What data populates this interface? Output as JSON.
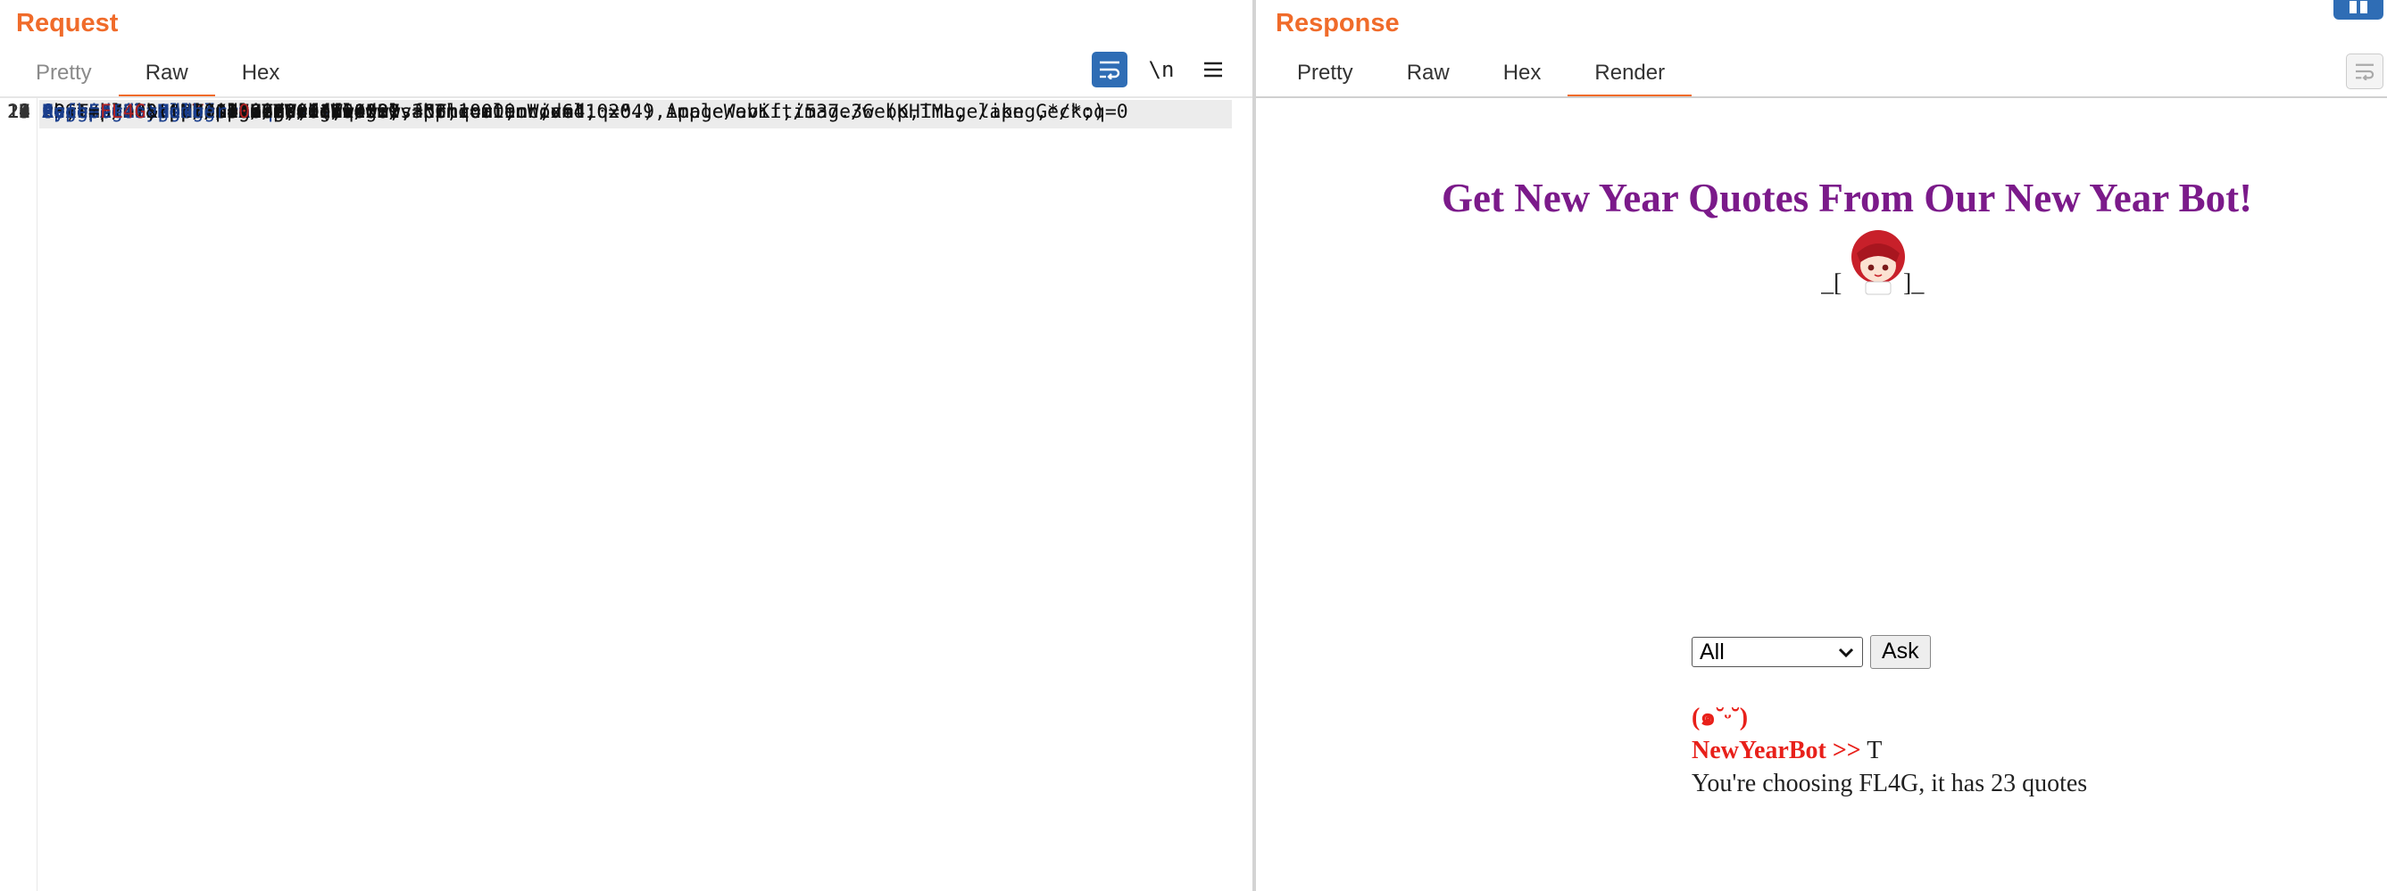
{
  "request": {
    "title": "Request",
    "tabs": [
      "Pretty",
      "Raw",
      "Hex"
    ],
    "active_tab": "Raw",
    "toolbar": {
      "wrap_icon": "wrap-lines-icon",
      "newline_label": "\\n",
      "menu_icon": "hamburger-menu-icon"
    },
    "lines": [
      {
        "n": "1",
        "key": "POST /?",
        "param": "debug",
        "eq": "=",
        "val": "True",
        "rest": " HTTP/1.1"
      },
      {
        "n": "2",
        "key": "Host",
        "rest": ": 127.0.0.1:5000"
      },
      {
        "n": "3",
        "key": "Content-Length",
        "rest": ": 18"
      },
      {
        "n": "4",
        "key": "Cache-Control",
        "rest": ": max-age=0"
      },
      {
        "n": "5",
        "key": "sec-ch-ua",
        "rest": ": \"-Not.A/Brand\";v=\"8\", \"Chromium\";v=\"102\""
      },
      {
        "n": "6",
        "key": "sec-ch-ua-mobile",
        "rest": ": ?0"
      },
      {
        "n": "7",
        "key": "sec-ch-ua-platform",
        "rest": ": \"Windows\""
      },
      {
        "n": "8",
        "key": "Upgrade-Insecure-Requests",
        "rest": ": 1"
      },
      {
        "n": "9",
        "key": "Origin",
        "rest": ": http://127.0.0.1:5000"
      },
      {
        "n": "10",
        "key": "Content-Type",
        "rest": ": application/x-www-form-urlencoded"
      },
      {
        "n": "11",
        "key": "User-Agent",
        "rest": ": Mozilla/5.0 (Windows NT 10.0; Win64; x64) AppleWebKit/537.36 (KHTML, like Gecko)"
      },
      {
        "n": "",
        "key": "",
        "rest": "Chrome/102.0.5005.63 Safari/537.36"
      },
      {
        "n": "12",
        "key": "Accept",
        "rest": ":"
      },
      {
        "n": "",
        "key": "",
        "rest": "text/html,application/xhtml+xml,application/xml;q=0.9,image/avif,image/webp,image/apng,*/*;q=0"
      },
      {
        "n": "",
        "key": "",
        "rest": ".8,application/signed-exchange;v=b3;q=0.9"
      },
      {
        "n": "13",
        "key": "Sec-Fetch-Site",
        "rest": ": same-origin"
      },
      {
        "n": "14",
        "key": "Sec-Fetch-Mode",
        "rest": ": navigate"
      },
      {
        "n": "15",
        "key": "Sec-Fetch-User",
        "rest": ": ?1"
      },
      {
        "n": "16",
        "key": "Sec-Fetch-Dest",
        "rest": ": document"
      },
      {
        "n": "17",
        "key": "Referer",
        "rest": ": http://127.0.0.1:5000/"
      },
      {
        "n": "18",
        "key": "Accept-Encoding",
        "rest": ": gzip, deflate"
      },
      {
        "n": "19",
        "key": "Accept-Language",
        "rest": ": en-US,en;q=0.9"
      },
      {
        "n": "20",
        "key": "Connection",
        "rest": ": close"
      },
      {
        "n": "21",
        "key": "",
        "rest": ""
      },
      {
        "n": "22",
        "body": true,
        "p1": "type",
        "v1": "FL4G",
        "p2": "number",
        "v2": "0"
      }
    ]
  },
  "response": {
    "title": "Response",
    "tabs": [
      "Pretty",
      "Raw",
      "Hex",
      "Render"
    ],
    "active_tab": "Render",
    "render": {
      "heading": "Get New Year Quotes From Our New Year Bot!",
      "face_left": "_[",
      "face_right": "]_",
      "select_value": "All",
      "ask_label": "Ask",
      "emote": "(๑˘ᵕ˘)",
      "bot_name": "NewYearBot >>",
      "bot_reply": " T",
      "status": "You're choosing FL4G, it has 23 quotes"
    }
  }
}
